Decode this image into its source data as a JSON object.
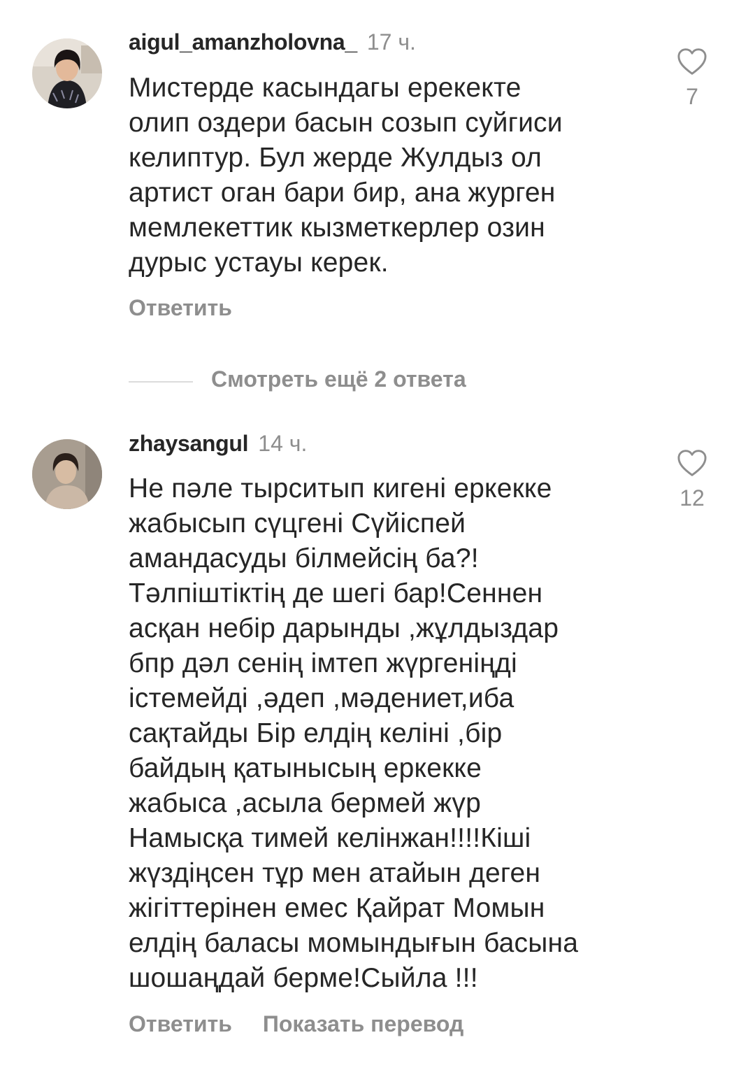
{
  "comments": [
    {
      "username": "aigul_amanzholovna_",
      "time": "17 ч.",
      "text": "Мистерде касындагы ерекекте\nолип оздери басын созып суйгиси\nкелиптур. Бул жерде Жулдыз ол\nартист оган бари бир, ана журген\nмемлекеттик кызметкерлер озин\nдурыс устауы керек.",
      "likes": "7",
      "reply_label": "Ответить",
      "avatar_icon": "profile-photo-icon"
    },
    {
      "username": "zhaysangul",
      "time": "14 ч.",
      "text": "Не пәле тырситып кигені еркекке\nжабысып сүцгені Сүйіспей\nамандасуды білмейсің ба?!\nТәлпіштіктің де шегі бар!Сеннен\nасқан небір дарынды ,жұлдыздар\nбпр дәл сенің імтеп жүргеніңді\nістемейді ,әдеп ,мәдениет,иба\nсақтайды Бір елдің келіні ,бір\nбайдың қатынысың еркекке\nжабыса ,асыла бермей жүр\nНамысқа тимей келінжан!!!!Кіші\nжүздіңсен тұр мен атайын деген\nжігіттерінен емес Қайрат Момын\nелдің баласы момындығын басына\nшошаңдай берме!Сыйла !!!",
      "likes": "12",
      "reply_label": "Ответить",
      "translate_label": "Показать перевод",
      "avatar_icon": "profile-photo-icon"
    }
  ],
  "view_more_replies": "Смотреть ещё 2 ответа",
  "icons": {
    "like": "heart-outline-icon"
  },
  "colors": {
    "text": "#262626",
    "secondary": "#8e8e8e",
    "divider": "#dbdbdb"
  }
}
